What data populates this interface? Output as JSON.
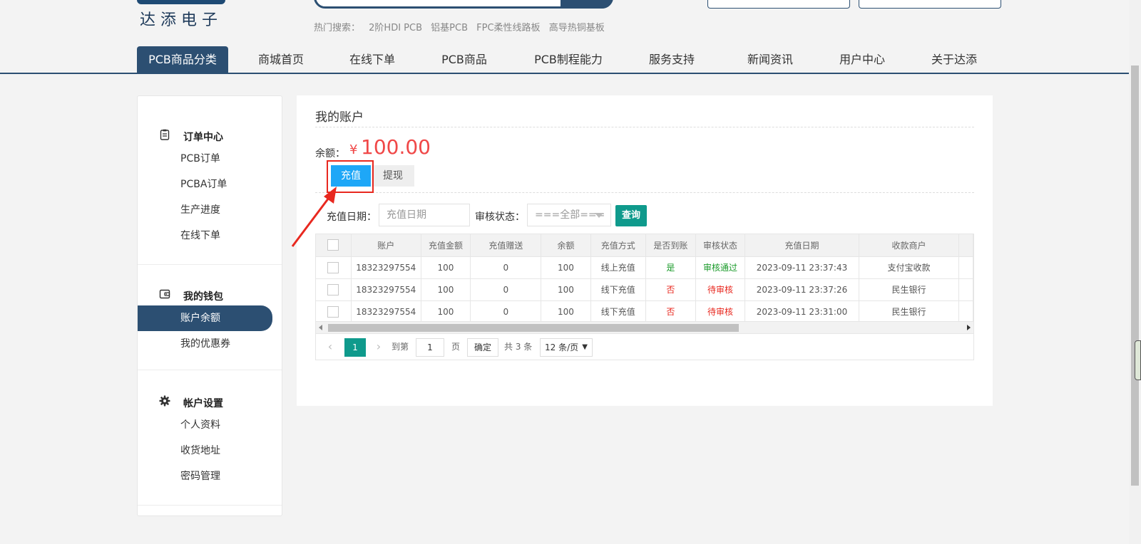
{
  "header": {
    "logo_text": "达添电子",
    "hot_search_label": "热门搜索：",
    "hot_search_items": [
      "2阶HDI PCB",
      "铝基PCB",
      "FPC柔性线路板",
      "高导热铜基板"
    ]
  },
  "nav": [
    {
      "label": "PCB商品分类",
      "active": true
    },
    {
      "label": "商城首页"
    },
    {
      "label": "在线下单"
    },
    {
      "label": "PCB商品"
    },
    {
      "label": "PCB制程能力"
    },
    {
      "label": "服务支持"
    },
    {
      "label": "新闻资讯"
    },
    {
      "label": "用户中心"
    },
    {
      "label": "关于达添"
    }
  ],
  "sidebar": {
    "groups": [
      {
        "title": "订单中心",
        "icon": "clipboard-icon",
        "items": [
          {
            "label": "PCB订单"
          },
          {
            "label": "PCBA订单"
          },
          {
            "label": "生产进度"
          },
          {
            "label": "在线下单"
          }
        ]
      },
      {
        "title": "我的钱包",
        "icon": "wallet-icon",
        "items": [
          {
            "label": "账户余额",
            "active": true
          },
          {
            "label": "我的优惠券"
          }
        ]
      },
      {
        "title": "帐户设置",
        "icon": "gear-icon",
        "items": [
          {
            "label": "个人资料"
          },
          {
            "label": "收货地址"
          },
          {
            "label": "密码管理"
          }
        ]
      }
    ]
  },
  "main": {
    "title": "我的账户",
    "balance_label": "余额：",
    "currency_symbol": "¥",
    "balance_value": "100.00",
    "tabs": {
      "recharge": "充值",
      "withdraw": "提现"
    },
    "filter": {
      "date_label": "充值日期：",
      "date_placeholder": "充值日期",
      "status_label": "审核状态：",
      "status_selected": "===全部===",
      "query_button": "查询"
    },
    "table": {
      "columns": [
        "账户",
        "充值金额",
        "充值赠送",
        "余额",
        "充值方式",
        "是否到账",
        "审核状态",
        "充值日期",
        "收款商户"
      ],
      "rows": [
        {
          "account": "18323297554",
          "amount": "100",
          "bonus": "0",
          "balance": "100",
          "method": "线上充值",
          "arrived": "是",
          "status": "审核通过",
          "date": "2023-09-11 23:37:43",
          "merchant": "支付宝收款"
        },
        {
          "account": "18323297554",
          "amount": "100",
          "bonus": "0",
          "balance": "100",
          "method": "线下充值",
          "arrived": "否",
          "status": "待审核",
          "date": "2023-09-11 23:37:26",
          "merchant": "民生银行"
        },
        {
          "account": "18323297554",
          "amount": "100",
          "bonus": "0",
          "balance": "100",
          "method": "线下充值",
          "arrived": "否",
          "status": "待审核",
          "date": "2023-09-11 23:31:00",
          "merchant": "民生银行"
        }
      ]
    },
    "pager": {
      "current_page": "1",
      "goto_label": "到第",
      "goto_value": "1",
      "page_suffix": "页",
      "confirm": "确定",
      "total": "共 3 条",
      "page_size": "12 条/页"
    }
  },
  "colors": {
    "brand": "#2c4f72",
    "accent": "#1ea7f7",
    "teal": "#0f9a8c",
    "price": "#f04848",
    "highlight": "#e8281f"
  }
}
